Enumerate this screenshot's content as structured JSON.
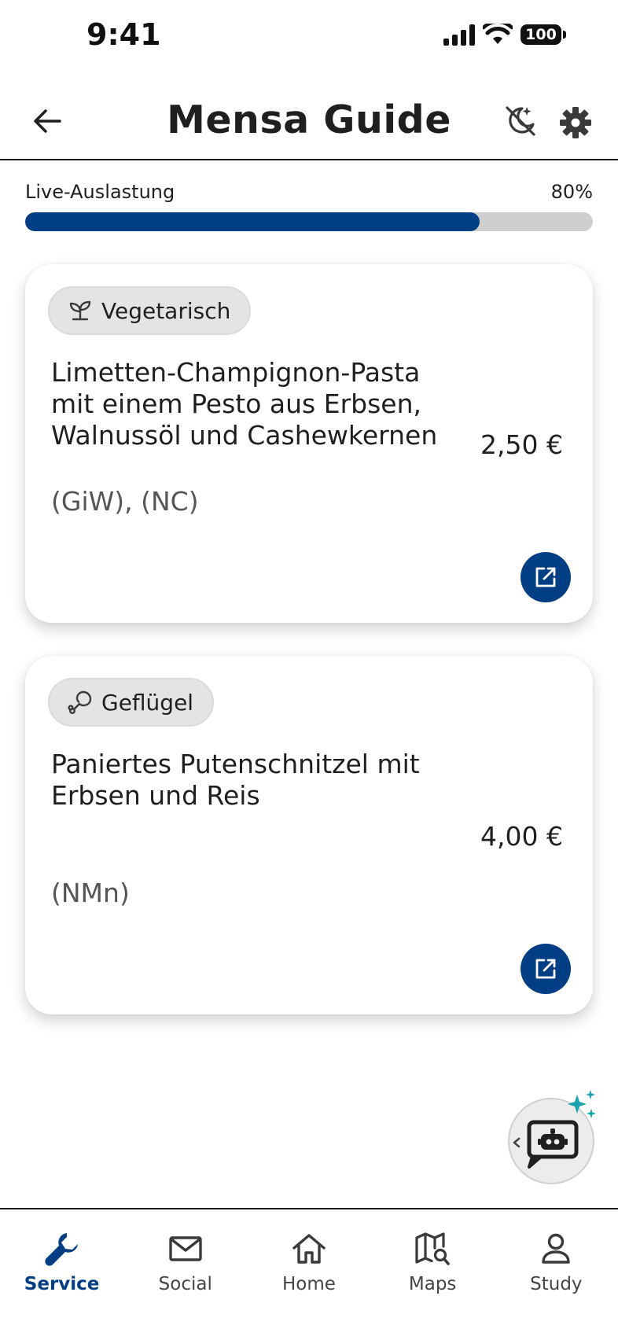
{
  "status_bar": {
    "time": "9:41",
    "battery": "100"
  },
  "header": {
    "title": "Mensa Guide"
  },
  "occupancy": {
    "label": "Live-Auslastung",
    "value_text": "80%",
    "fraction": 0.8
  },
  "colors": {
    "accent": "#023e84",
    "track": "#cfcfcf",
    "tag_bg": "#e4e4e4",
    "sparkle": "#1aa3ad"
  },
  "meals": [
    {
      "tag_label": "Vegetarisch",
      "tag_icon": "plant-icon",
      "name": "Limetten-Champignon-Pasta mit einem Pesto aus Erbsen, Walnussöl und Cashewkernen",
      "price": "2,50 €",
      "allergens": "(GiW), (NC)"
    },
    {
      "tag_label": "Geflügel",
      "tag_icon": "drumstick-icon",
      "name": "Paniertes Putenschnitzel mit Erbsen und Reis",
      "price": "4,00 €",
      "allergens": "(NMn)"
    }
  ],
  "bottom_nav": {
    "active": "Service",
    "items": [
      {
        "label": "Service",
        "icon": "wrench-icon"
      },
      {
        "label": "Social",
        "icon": "mail-icon"
      },
      {
        "label": "Home",
        "icon": "home-icon"
      },
      {
        "label": "Maps",
        "icon": "map-search-icon"
      },
      {
        "label": "Study",
        "icon": "person-icon"
      }
    ]
  }
}
